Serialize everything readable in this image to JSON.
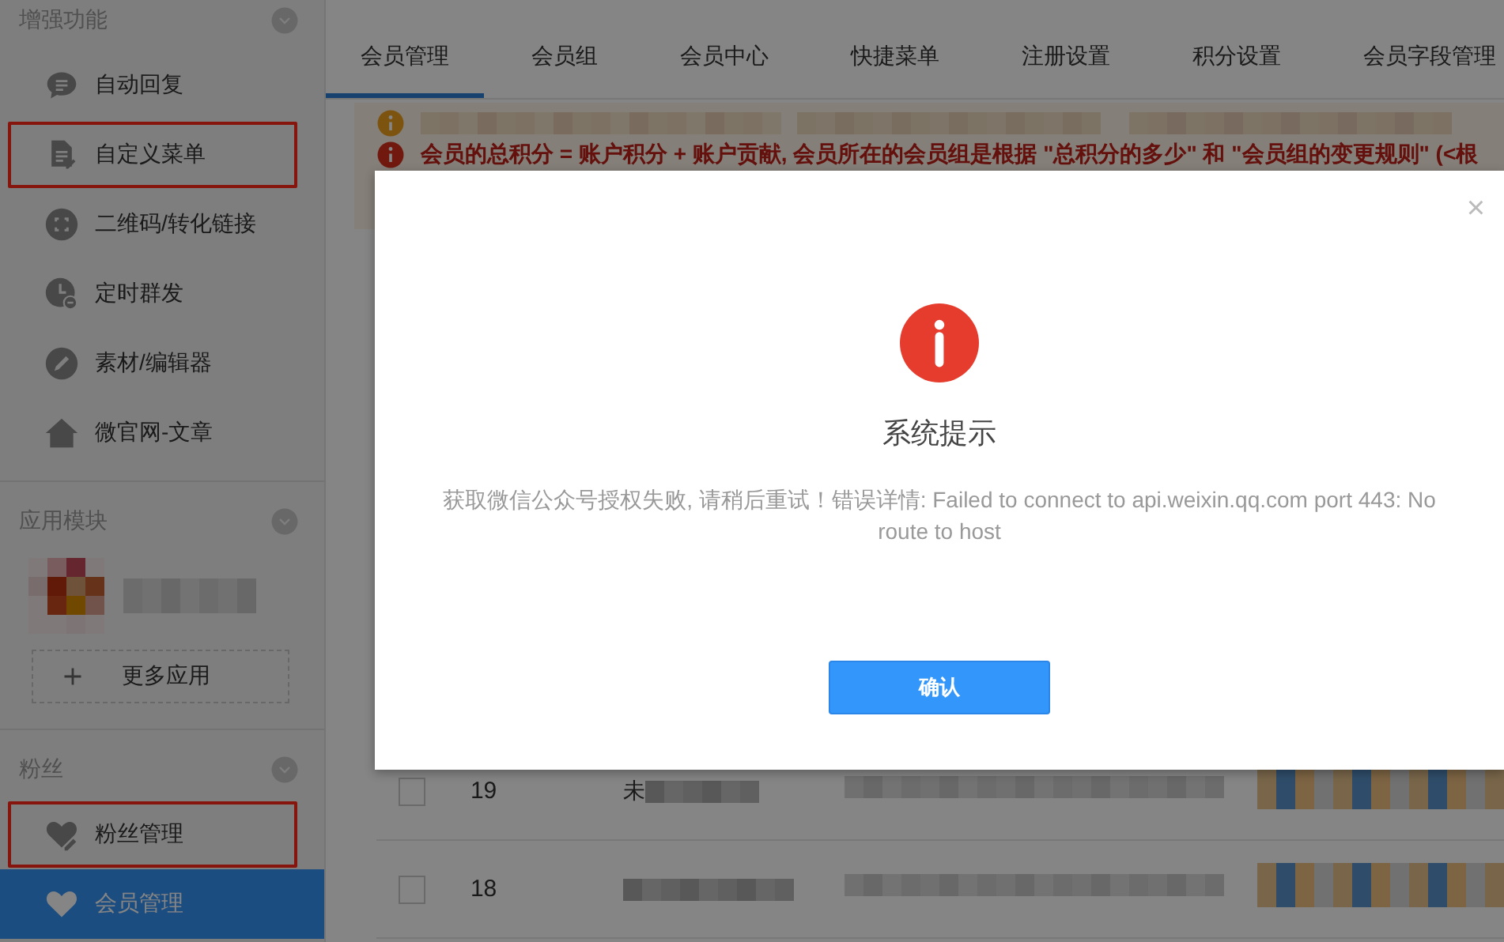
{
  "sidebar": {
    "sections": [
      {
        "kind": "menu",
        "title": "增强功能",
        "items": [
          {
            "label": "自动回复",
            "highlighted": false,
            "selected": false
          },
          {
            "label": "自定义菜单",
            "highlighted": true,
            "selected": false
          },
          {
            "label": "二维码/转化链接",
            "highlighted": false,
            "selected": false
          },
          {
            "label": "定时群发",
            "highlighted": false,
            "selected": false
          },
          {
            "label": "素材/编辑器",
            "highlighted": false,
            "selected": false
          },
          {
            "label": "微官网-文章",
            "highlighted": false,
            "selected": false
          }
        ]
      },
      {
        "kind": "apps",
        "title": "应用模块",
        "more_label": "更多应用"
      },
      {
        "kind": "menu",
        "title": "粉丝",
        "items": [
          {
            "label": "粉丝管理",
            "highlighted": true,
            "selected": false
          },
          {
            "label": "会员管理",
            "highlighted": false,
            "selected": true
          }
        ]
      }
    ]
  },
  "tabs": [
    {
      "label": "会员管理",
      "selected": true
    },
    {
      "label": "会员组",
      "selected": false
    },
    {
      "label": "会员中心",
      "selected": false
    },
    {
      "label": "快捷菜单",
      "selected": false
    },
    {
      "label": "注册设置",
      "selected": false
    },
    {
      "label": "积分设置",
      "selected": false
    },
    {
      "label": "会员字段管理",
      "selected": false
    }
  ],
  "notices": [
    {
      "kind": "warning"
    },
    {
      "kind": "error",
      "text": "会员的总积分 = 账户积分 + 账户贡献, 会员所在的会员组是根据 \"总积分的多少\" 和 \"会员组的变更规则\" (<根"
    }
  ],
  "table": {
    "rows": [
      {
        "number": "19",
        "checked": false,
        "column_2": "未"
      },
      {
        "number": "18",
        "checked": false
      }
    ]
  },
  "dialog": {
    "close": "×",
    "title": "系统提示",
    "message": "获取微信公众号授权失败, 请稍后重试！错误详情: Failed to connect to api.weixin.qq.com port 443: No route to host",
    "button": "确认"
  }
}
